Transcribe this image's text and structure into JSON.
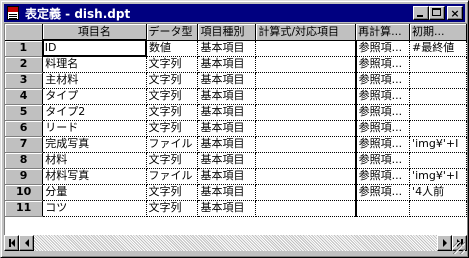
{
  "window": {
    "title": "表定義 - dish.dpt",
    "buttons": {
      "minimize": "minimize",
      "maximize": "maximize",
      "close": "×"
    }
  },
  "grid": {
    "columns": [
      {
        "label": ""
      },
      {
        "label": "項目名"
      },
      {
        "label": "データ型"
      },
      {
        "label": "項目種別"
      },
      {
        "label": "計算式/対応項目"
      },
      {
        "label": "再計算..."
      },
      {
        "label": "初期..."
      }
    ],
    "rows": [
      {
        "num": "1",
        "name": "ID",
        "type": "数値",
        "kind": "基本項目",
        "formula": "",
        "recalc": "参照項...",
        "init": "#最終値"
      },
      {
        "num": "2",
        "name": "料理名",
        "type": "文字列",
        "kind": "基本項目",
        "formula": "",
        "recalc": "参照項...",
        "init": ""
      },
      {
        "num": "3",
        "name": "主材料",
        "type": "文字列",
        "kind": "基本項目",
        "formula": "",
        "recalc": "参照項...",
        "init": ""
      },
      {
        "num": "4",
        "name": "タイプ",
        "type": "文字列",
        "kind": "基本項目",
        "formula": "",
        "recalc": "参照項...",
        "init": ""
      },
      {
        "num": "5",
        "name": "タイプ2",
        "type": "文字列",
        "kind": "基本項目",
        "formula": "",
        "recalc": "参照項...",
        "init": ""
      },
      {
        "num": "6",
        "name": "リード",
        "type": "文字列",
        "kind": "基本項目",
        "formula": "",
        "recalc": "参照項...",
        "init": ""
      },
      {
        "num": "7",
        "name": "完成写真",
        "type": "ファイル",
        "kind": "基本項目",
        "formula": "",
        "recalc": "参照項...",
        "init": "'img¥'+I"
      },
      {
        "num": "8",
        "name": "材料",
        "type": "文字列",
        "kind": "基本項目",
        "formula": "",
        "recalc": "参照項...",
        "init": ""
      },
      {
        "num": "9",
        "name": "材料写真",
        "type": "ファイル",
        "kind": "基本項目",
        "formula": "",
        "recalc": "参照項...",
        "init": "'img¥'+I"
      },
      {
        "num": "10",
        "name": "分量",
        "type": "文字列",
        "kind": "基本項目",
        "formula": "",
        "recalc": "参照項...",
        "init": "'4人前"
      },
      {
        "num": "11",
        "name": "コツ",
        "type": "文字列",
        "kind": "基本項目",
        "formula": "",
        "recalc": "",
        "init": ""
      }
    ]
  },
  "colors": {
    "titlebar": "#000080",
    "face": "#c0c0c0",
    "cell": "#ffffff"
  }
}
